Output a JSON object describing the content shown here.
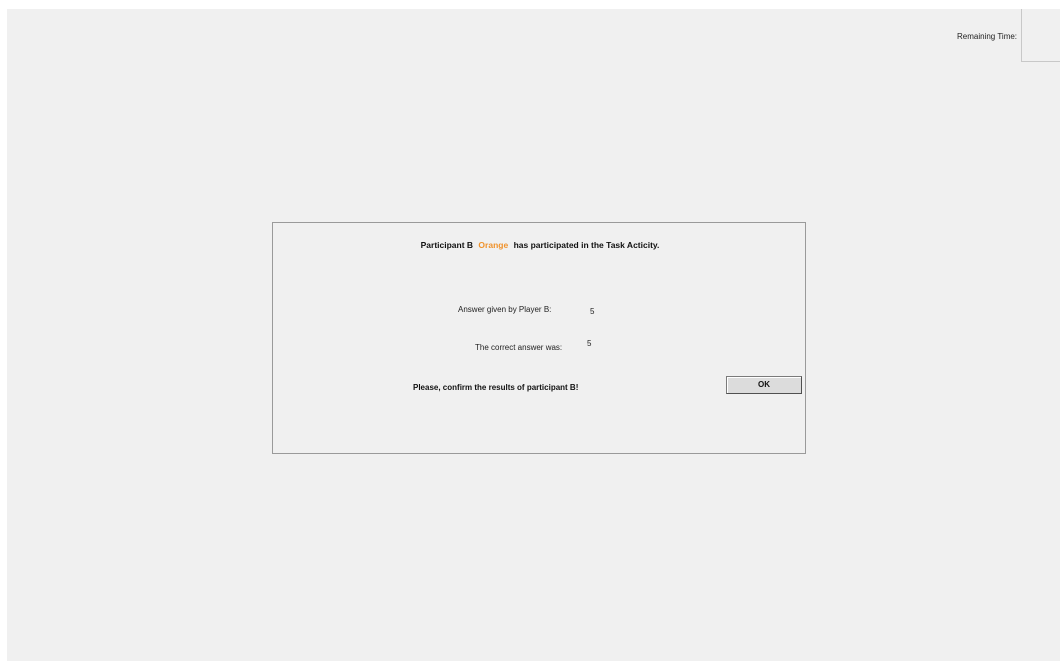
{
  "header": {
    "remaining_time_label": "Remaining Time:",
    "remaining_time_value": ""
  },
  "dialog": {
    "headline_prefix": "Participant B",
    "participant_name": "Orange",
    "headline_suffix": "has participated in the Task Acticity.",
    "answer_given_label": "Answer given by Player B:",
    "answer_given_value": "5",
    "correct_answer_label": "The correct answer was:",
    "correct_answer_value": "5",
    "confirm_prompt": "Please, confirm the results of participant B!",
    "ok_label": "OK"
  },
  "colors": {
    "participant_name": "#f0922b",
    "background": "#f0f0f0"
  }
}
